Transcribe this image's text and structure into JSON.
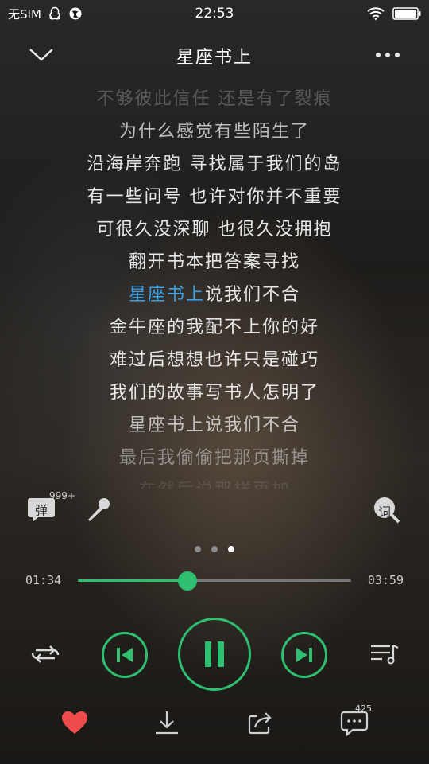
{
  "status": {
    "carrier": "无SIM",
    "time": "22:53"
  },
  "header": {
    "title": "星座书上"
  },
  "lyrics": {
    "lines": [
      "不够彼此信任 还是有了裂痕",
      "为什么感觉有些陌生了",
      "沿海岸奔跑 寻找属于我们的岛",
      "有一些问号 也许对你并不重要",
      "可很久没深聊 也很久没拥抱",
      "翻开书本把答案寻找"
    ],
    "current_highlight": "星座书上",
    "current_rest": "说我们不合",
    "after": [
      "金牛座的我配不上你的好",
      "难过后想想也许只是碰巧",
      "我们的故事写书人怎明了",
      "星座书上说我们不合",
      "最后我偷偷把那页撕掉",
      "在然后说那样再加"
    ],
    "highlight_color": "#3aa0e8"
  },
  "tools": {
    "danmu_label": "弹",
    "danmu_count": "999+",
    "lyric_label": "词"
  },
  "pager": {
    "count": 3,
    "active_index": 2
  },
  "player": {
    "current_time": "01:34",
    "total_time": "03:59",
    "progress_fraction": 0.4,
    "accent": "#2fbf71"
  },
  "actions": {
    "comment_count": "425",
    "heart_color": "#ee4c4c"
  }
}
